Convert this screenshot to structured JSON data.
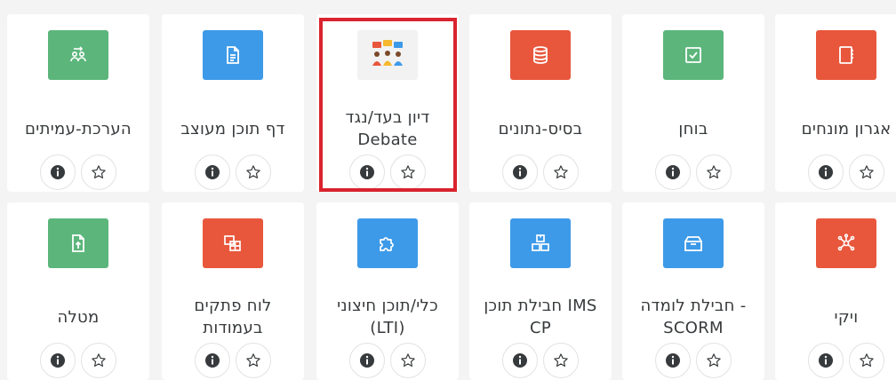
{
  "colors": {
    "green": "#5cb67c",
    "blue": "#3d9ae8",
    "red": "#e8573c",
    "text": "#373a3c",
    "highlight": "#d9232e"
  },
  "row1": [
    {
      "label": "אגרון מונחים",
      "label2": "",
      "icon": "glossary-icon"
    },
    {
      "label": "בוחן",
      "label2": "",
      "icon": "quiz-icon"
    },
    {
      "label": "בסיס-נתונים",
      "label2": "",
      "icon": "database-icon"
    },
    {
      "label": "דיון בעד/נגד",
      "label2": "Debate",
      "icon": "debate-icon"
    },
    {
      "label": "דף תוכן מעוצב",
      "label2": "",
      "icon": "page-icon"
    },
    {
      "label": "הערכת-עמיתים",
      "label2": "",
      "icon": "workshop-icon"
    }
  ],
  "row2": [
    {
      "label": "ויקי",
      "label2": "",
      "icon": "wiki-icon"
    },
    {
      "label": "חבילת לומדה -",
      "label2": "SCORM",
      "icon": "scorm-package-icon"
    },
    {
      "label": "חבילת תוכן IMS",
      "label2": "CP",
      "icon": "ims-package-icon"
    },
    {
      "label": "כלי/תוכן חיצוני",
      "label2": "(LTI)",
      "icon": "puzzle-icon"
    },
    {
      "label": "לוח פתקים",
      "label2": "בעמודות",
      "icon": "board-icon"
    },
    {
      "label": "מטלה",
      "label2": "",
      "icon": "assignment-upload-icon"
    }
  ]
}
